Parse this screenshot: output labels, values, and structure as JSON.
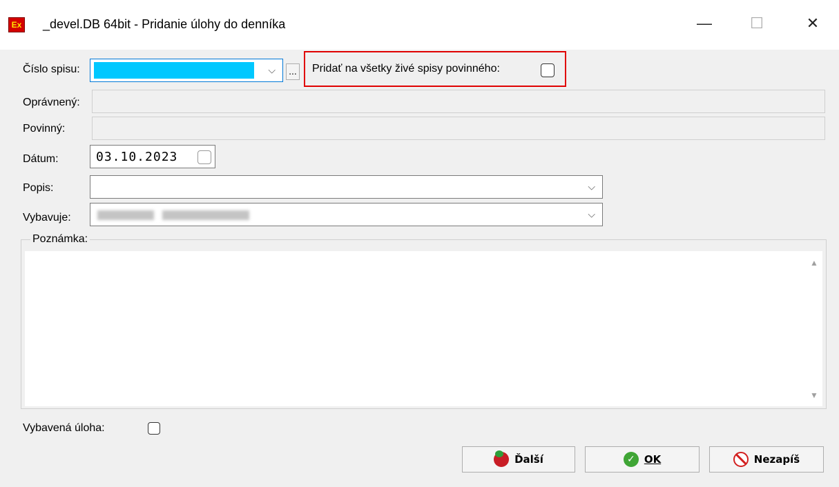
{
  "window": {
    "title": "_devel.DB 64bit - Pridanie úlohy do denníka",
    "icon_text": "Ex",
    "minimize": "—",
    "maximize": "☐",
    "close": "✕"
  },
  "form": {
    "cislo_spisu": {
      "label": "Číslo spisu:",
      "value": "",
      "browse": "..."
    },
    "pridat_all": {
      "label": "Pridať na všetky živé spisy povinného:",
      "checked": false
    },
    "opravneny": {
      "label": "Oprávnený:",
      "value": ""
    },
    "povinny": {
      "label": "Povinný:",
      "value": ""
    },
    "datum": {
      "label": "Dátum:",
      "value": "03.10.2023"
    },
    "popis": {
      "label": "Popis:",
      "value": ""
    },
    "vybavuje": {
      "label": "Vybavuje:",
      "value": ""
    },
    "poznamka": {
      "label": "Poznámka:",
      "value": ""
    },
    "vybavena": {
      "label": "Vybavená úloha:",
      "checked": false
    }
  },
  "buttons": {
    "dalsi": "Ďalší",
    "ok": "OK",
    "nezapis": "Nezapíš"
  },
  "colors": {
    "highlight_fill": "#00c8ff",
    "annotation_border": "#e00000"
  }
}
